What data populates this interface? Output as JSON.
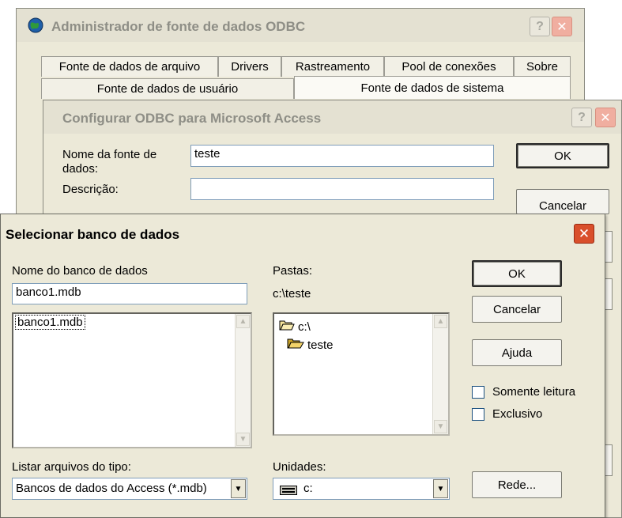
{
  "odbc_admin": {
    "title": "Administrador de fonte de dados ODBC",
    "help": "?",
    "close": "✕",
    "tabs_row1": [
      "Fonte de dados de arquivo",
      "Drivers",
      "Rastreamento",
      "Pool de conexões",
      "Sobre"
    ],
    "tabs_row2": [
      "Fonte de dados de usuário",
      "Fonte de dados de sistema"
    ]
  },
  "access_config": {
    "title": "Configurar ODBC para Microsoft Access",
    "help": "?",
    "close": "✕",
    "name_label_line1": "Nome da fonte de",
    "name_label_line2": "dados:",
    "name_value": "teste",
    "desc_label": "Descrição:",
    "desc_value": "",
    "ok": "OK",
    "cancel": "Cancelar"
  },
  "select_db": {
    "title": "Selecionar banco de dados",
    "close": "✕",
    "db_name_label": "Nome do banco de dados",
    "db_name_value": "banco1.mdb",
    "files": [
      "banco1.mdb"
    ],
    "folders_label": "Pastas:",
    "current_path": "c:\\teste",
    "folders": [
      "c:\\",
      "teste"
    ],
    "filetype_label": "Listar arquivos do tipo:",
    "filetype_value": "Bancos de dados do Access (*.mdb)",
    "drives_label": "Unidades:",
    "drive_value": "c:",
    "ok": "OK",
    "cancel": "Cancelar",
    "help_btn": "Ajuda",
    "readonly": {
      "label": "Somente leitura",
      "checked": false
    },
    "exclusive": {
      "label": "Exclusivo",
      "checked": false
    },
    "network": "Rede..."
  }
}
